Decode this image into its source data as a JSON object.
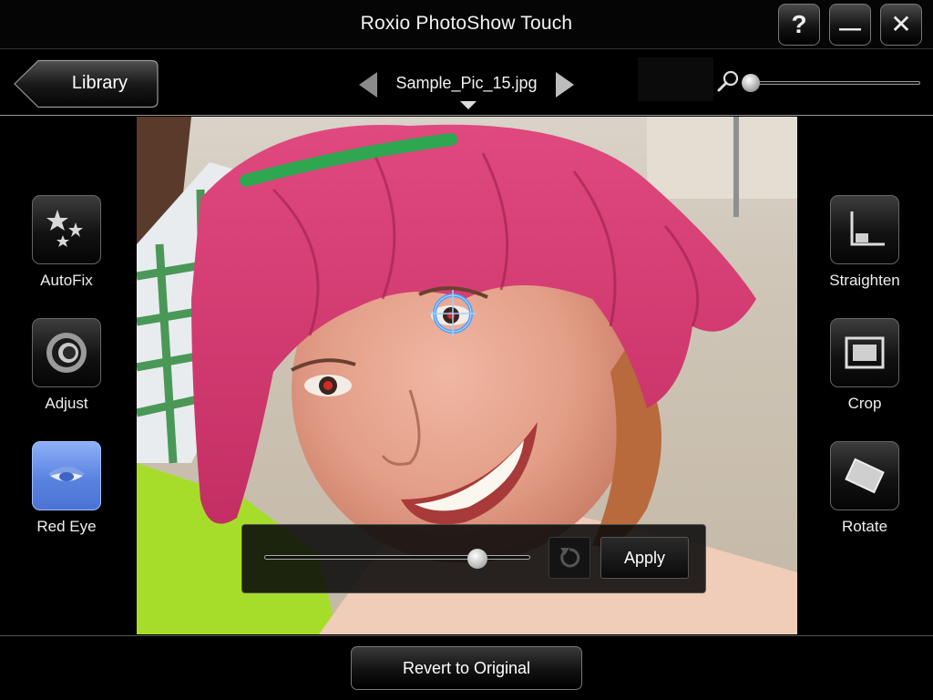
{
  "window": {
    "title": "Roxio PhotoShow Touch",
    "help_label": "?",
    "minimize_label": "—",
    "close_label": "✕"
  },
  "toolbar": {
    "library_label": "Library",
    "filename": "Sample_Pic_15.jpg",
    "zoom_level": 0.02
  },
  "left_tools": [
    {
      "label": "AutoFix",
      "icon": "stars-icon",
      "active": false
    },
    {
      "label": "Adjust",
      "icon": "adjust-ring-icon",
      "active": false
    },
    {
      "label": "Red Eye",
      "icon": "eye-icon",
      "active": true
    }
  ],
  "right_tools": [
    {
      "label": "Straighten",
      "icon": "straighten-icon"
    },
    {
      "label": "Crop",
      "icon": "crop-icon"
    },
    {
      "label": "Rotate",
      "icon": "rotate-icon"
    }
  ],
  "redeye_panel": {
    "slider_value": 0.8,
    "undo_icon": "undo-icon",
    "apply_label": "Apply"
  },
  "bottom": {
    "revert_label": "Revert to Original"
  },
  "colors": {
    "active_tool": "#5a83e0",
    "target_ring": "#4aa0ff"
  }
}
